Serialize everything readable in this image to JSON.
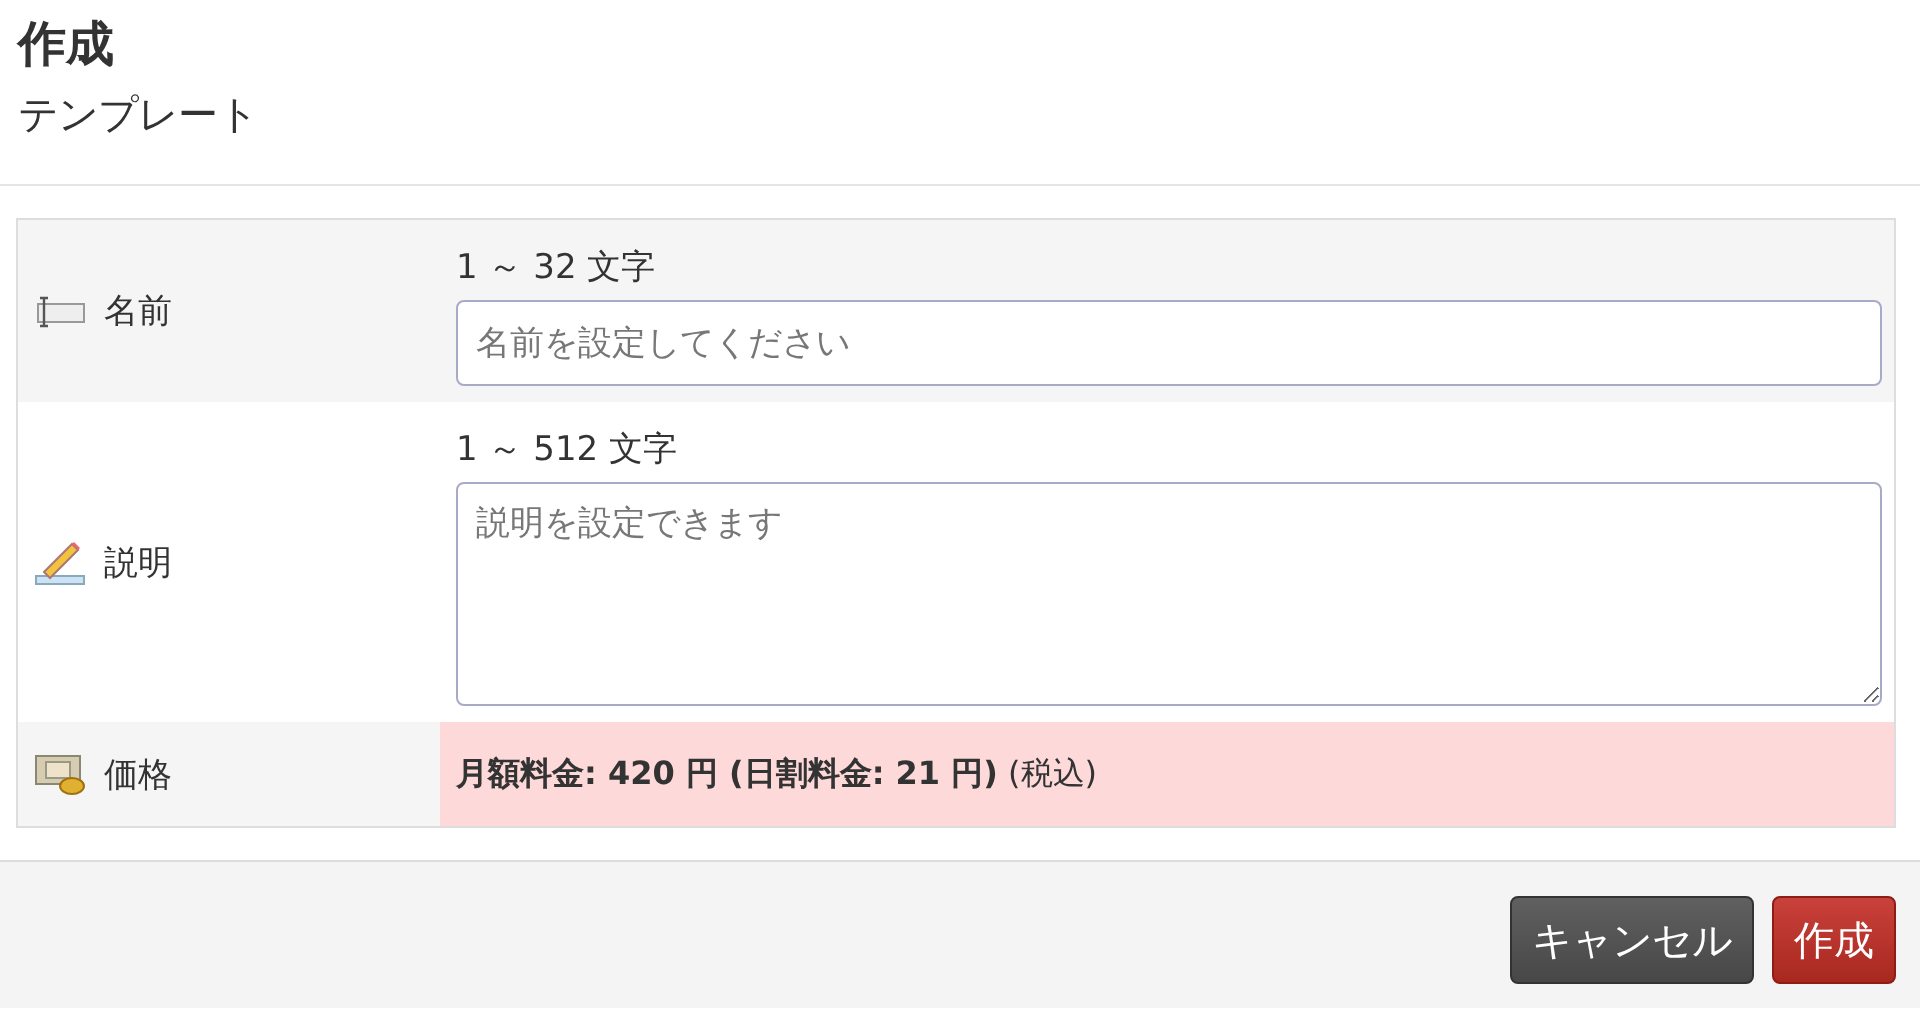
{
  "header": {
    "title": "作成",
    "subtitle": "テンプレート"
  },
  "rows": [
    {
      "kind": "input",
      "label": "名前",
      "hint": "1 ～ 32 文字",
      "placeholder": "名前を設定してください"
    },
    {
      "kind": "textarea",
      "label": "説明",
      "hint": "1 ～ 512 文字",
      "placeholder": "説明を設定できます"
    },
    {
      "kind": "price",
      "label": "価格",
      "text": "**月額料金: 420 円 (日割料金: 21 円)** (税込)"
    }
  ],
  "buttons": [
    {
      "label": "キャンセル",
      "kind": "cancel"
    },
    {
      "label": "作成",
      "kind": "primary"
    }
  ]
}
